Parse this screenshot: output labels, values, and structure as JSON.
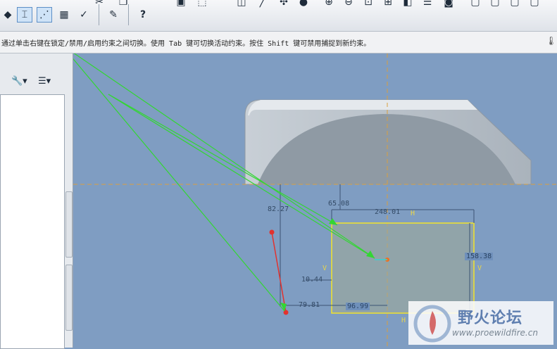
{
  "toolbar": {
    "icons": [
      "undo-icon",
      "redo-icon",
      "cut-icon",
      "copy-icon",
      "paste-icon",
      "save-icon",
      "view-icon",
      "sketch-icon",
      "constraint-icon",
      "select-icon",
      "sphere-icon",
      "zoom-in-icon",
      "zoom-out-icon",
      "refit-icon",
      "datum-icon",
      "plane-icon",
      "camera-icon",
      "box-icon"
    ],
    "help_icon": "?"
  },
  "status": {
    "message": "通过单击右键在锁定/禁用/启用约束之间切换。使用 Tab 键可切换活动约束。按住 Shift 键可禁用捕捉到新约束。"
  },
  "sketch": {
    "dimensions": {
      "d1": "82.27",
      "d2": "65.08",
      "d3": "248.01",
      "d4": "158.38",
      "d5": "10.44",
      "d6": "79.81",
      "d7": "96.99"
    },
    "constraint_labels": {
      "h_top": "H",
      "h_bottom": "H",
      "v_left": "V",
      "v_right": "V"
    }
  },
  "watermark": {
    "title": "野火论坛",
    "url": "www.proewildfire.cn"
  },
  "colors": {
    "background": "#7f9dc2",
    "sketch_line": "#f2e32a",
    "guide": "#d9a040",
    "arrow": "#33d633"
  }
}
